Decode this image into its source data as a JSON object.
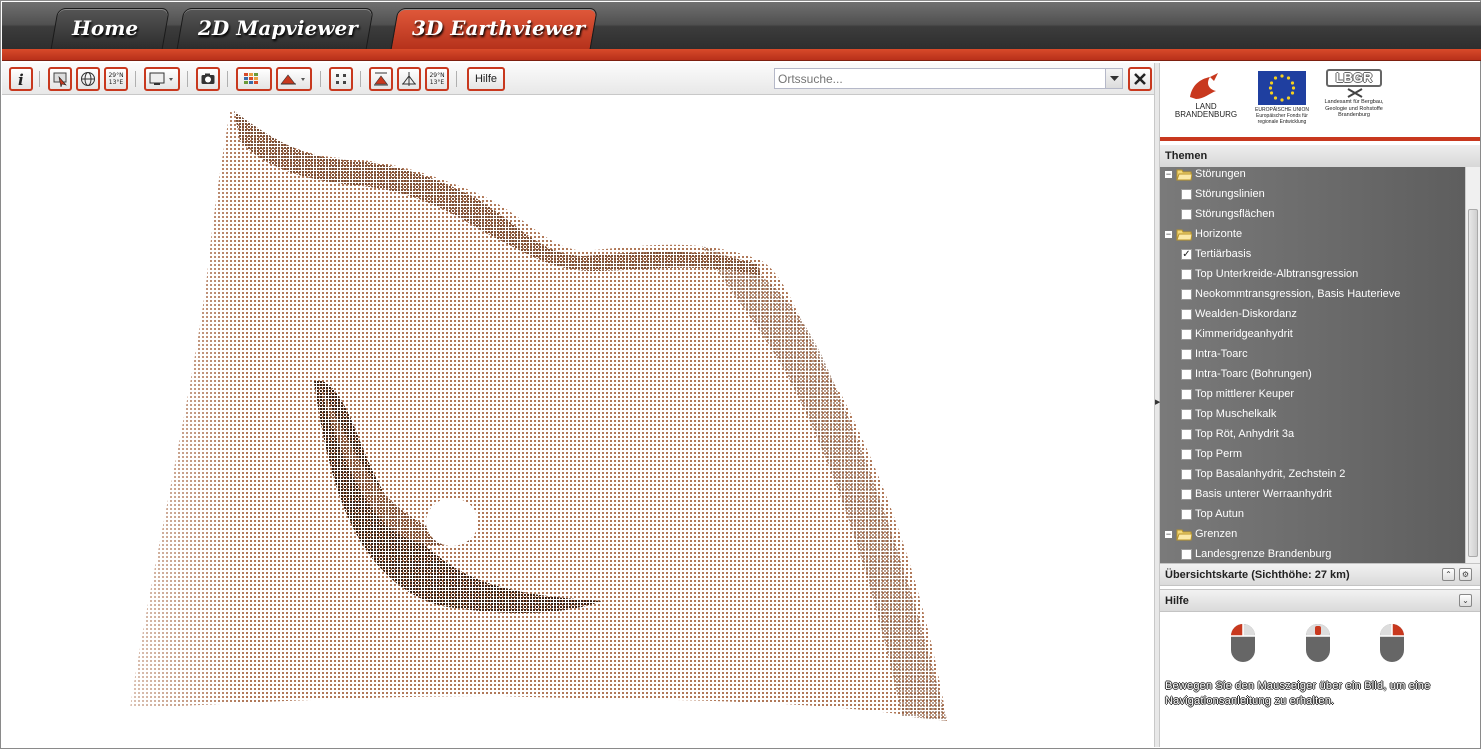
{
  "nav": {
    "tabs": [
      {
        "label": "Home",
        "active": false
      },
      {
        "label": "2D Mapviewer",
        "active": false
      },
      {
        "label": "3D Earthviewer",
        "active": true
      }
    ]
  },
  "toolbar": {
    "coord_label_lat": "29°N",
    "coord_label_lon": "13°E",
    "help_label": "Hilfe",
    "search_placeholder": "Ortssuche..."
  },
  "logos": {
    "brandenburg": "LAND\nBRANDENBURG",
    "eu_caption": "EUROPÄISCHE UNION\nEuropäischer Fonds für\nregionale Entwicklung",
    "lbgr_title": "LBGR",
    "lbgr_caption": "Landesamt für Bergbau,\nGeologie und Rohstoffe\nBrandenburg"
  },
  "panels": {
    "themen_title": "Themen",
    "overview_title": "Übersichtskarte (Sichthöhe: 27 km)",
    "hilfe_title": "Hilfe",
    "hilfe_text": "Bewegen Sie den Mauszeiger über ein Bild, um eine Navigationsanleitung zu erhalten."
  },
  "tree": [
    {
      "type": "folder",
      "label": "Störungen"
    },
    {
      "type": "leaf",
      "label": "Störungslinien",
      "checked": false
    },
    {
      "type": "leaf",
      "label": "Störungsflächen",
      "checked": false
    },
    {
      "type": "folder",
      "label": "Horizonte"
    },
    {
      "type": "leaf",
      "label": "Tertiärbasis",
      "checked": true
    },
    {
      "type": "leaf",
      "label": "Top Unterkreide-Albtransgression",
      "checked": false
    },
    {
      "type": "leaf",
      "label": "Neokommtransgression, Basis Hauterieve",
      "checked": false
    },
    {
      "type": "leaf",
      "label": "Wealden-Diskordanz",
      "checked": false
    },
    {
      "type": "leaf",
      "label": "Kimmeridgeanhydrit",
      "checked": false
    },
    {
      "type": "leaf",
      "label": "Intra-Toarc",
      "checked": false
    },
    {
      "type": "leaf",
      "label": "Intra-Toarc (Bohrungen)",
      "checked": false
    },
    {
      "type": "leaf",
      "label": "Top mittlerer Keuper",
      "checked": false
    },
    {
      "type": "leaf",
      "label": "Top Muschelkalk",
      "checked": false
    },
    {
      "type": "leaf",
      "label": "Top Röt, Anhydrit 3a",
      "checked": false
    },
    {
      "type": "leaf",
      "label": "Top Perm",
      "checked": false
    },
    {
      "type": "leaf",
      "label": "Top Basalanhydrit, Zechstein 2",
      "checked": false
    },
    {
      "type": "leaf",
      "label": "Basis unterer Werraanhydrit",
      "checked": false
    },
    {
      "type": "leaf",
      "label": "Top Autun",
      "checked": false
    },
    {
      "type": "folder",
      "label": "Grenzen"
    },
    {
      "type": "leaf",
      "label": "Landesgrenze Brandenburg",
      "checked": false
    }
  ],
  "colors": {
    "accent": "#c8381e",
    "surface_light": "#b5795a",
    "surface_dark": "#2a1a12",
    "tree_bg": "#6e6e6e"
  }
}
